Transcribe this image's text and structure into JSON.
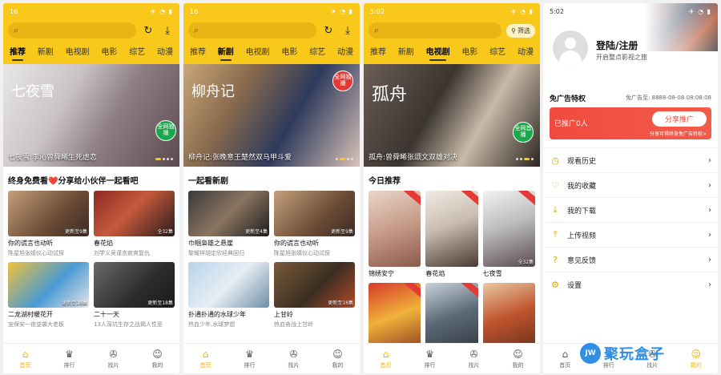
{
  "colors": {
    "accent": "#f8c81b",
    "promo": "#f14a3e",
    "tab_active": "#f0b400"
  },
  "screens": [
    {
      "status_time": "16",
      "tabs": [
        "推荐",
        "新剧",
        "电视剧",
        "电影",
        "综艺",
        "动漫"
      ],
      "active_tab": 0,
      "banner": {
        "caption": "七夜雪:李沁曾舜晞生死虐恋",
        "logo": "七夜雪",
        "badge": "全网独播"
      },
      "section_title": "终身免费看❤️分享给小伙伴一起看吧",
      "cards": [
        {
          "title": "你的谎言也动听",
          "sub": "陈星旭张婧仪心动试探",
          "upd": "更新至9集"
        },
        {
          "title": "春花焰",
          "sub": "刘学义吴谨言疯爽复仇",
          "upd": "全32集"
        },
        {
          "title": "二龙湖村暖花开",
          "sub": "宠保安一夜逆袭大老板",
          "upd": "更新至18集"
        },
        {
          "title": "二十一天",
          "sub": "13人深坑生存之战揭人性恶",
          "upd": "更新至18集"
        }
      ]
    },
    {
      "status_time": "16",
      "tabs": [
        "推荐",
        "新剧",
        "电视剧",
        "电影",
        "综艺",
        "动漫"
      ],
      "active_tab": 1,
      "banner": {
        "caption": "柳舟记:张晚意王楚然双马甲斗爱",
        "logo": "柳舟记",
        "badge": "全网独播"
      },
      "section_title": "一起看新剧",
      "cards": [
        {
          "title": "巾帼枭雄之悬崖",
          "sub": "黎耀祥胡定欣经典回归",
          "upd": "更新至4集"
        },
        {
          "title": "你的谎言也动听",
          "sub": "陈星旭张婧仪心动试探",
          "upd": "更新至9集"
        },
        {
          "title": "扑通扑通的水球少年",
          "sub": "热血少年,水球梦想",
          "upd": ""
        },
        {
          "title": "上甘岭",
          "sub": "热血奋战上甘岭",
          "upd": "更新至18集"
        }
      ]
    },
    {
      "status_time": "5:02",
      "tabs": [
        "推荐",
        "新剧",
        "电视剧",
        "电影",
        "综艺",
        "动漫"
      ],
      "active_tab": 2,
      "filter": "筛选",
      "banner": {
        "caption": "孤舟:曾舜晞张颂文双雄对决",
        "logo": "孤舟",
        "badge": "全网首播"
      },
      "section_title": "今日推荐",
      "cards": [
        {
          "title": "锦绣安宁",
          "upd": ""
        },
        {
          "title": "春花焰",
          "upd": ""
        },
        {
          "title": "七夜雪",
          "upd": "全32集"
        },
        {
          "title": "",
          "upd": ""
        },
        {
          "title": "",
          "upd": ""
        },
        {
          "title": "",
          "upd": ""
        }
      ]
    }
  ],
  "tabbar": [
    "首页",
    "排行",
    "找片",
    "我的"
  ],
  "profile": {
    "status_time": "5:02",
    "login": "登陆/注册",
    "login_sub": "开启整点影视之旅",
    "vip_label": "免广告特权",
    "vip_until": "免广告至: 8888-08-08 08:08:08",
    "promo_label": "已推广0人",
    "promo_button": "分享推广",
    "promo_sub": "分享可得终身免广告特权>",
    "menu": [
      {
        "label": "观看历史",
        "icon": "history-icon"
      },
      {
        "label": "我的收藏",
        "icon": "heart-icon"
      },
      {
        "label": "我的下载",
        "icon": "download-icon"
      },
      {
        "label": "上传视频",
        "icon": "upload-icon"
      },
      {
        "label": "意见反馈",
        "icon": "feedback-icon"
      },
      {
        "label": "设置",
        "icon": "gear-icon"
      }
    ]
  },
  "watermark": {
    "badge": "JW",
    "text": "聚玩盒子"
  }
}
